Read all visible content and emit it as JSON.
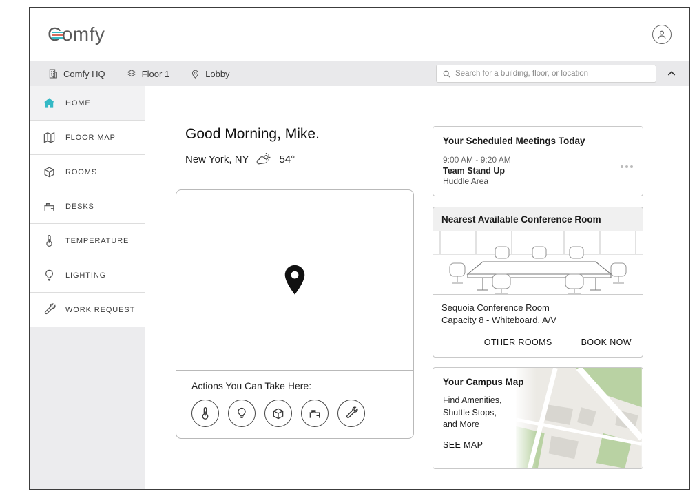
{
  "colors": {
    "accent": "#35b9c5",
    "logo_red": "#d96a5b"
  },
  "header": {
    "logo": "Comfy"
  },
  "breadcrumb": {
    "items": [
      {
        "icon": "building-icon",
        "label": "Comfy HQ"
      },
      {
        "icon": "layers-icon",
        "label": "Floor 1"
      },
      {
        "icon": "pin-icon",
        "label": "Lobby"
      }
    ]
  },
  "search": {
    "placeholder": "Search for a building, floor, or location"
  },
  "sidebar": {
    "items": [
      {
        "label": "HOME",
        "icon": "home-icon",
        "active": true
      },
      {
        "label": "FLOOR MAP",
        "icon": "floor-map-icon",
        "active": false
      },
      {
        "label": "ROOMS",
        "icon": "rooms-icon",
        "active": false
      },
      {
        "label": "DESKS",
        "icon": "desks-icon",
        "active": false
      },
      {
        "label": "TEMPERATURE",
        "icon": "thermometer-icon",
        "active": false
      },
      {
        "label": "LIGHTING",
        "icon": "lightbulb-icon",
        "active": false
      },
      {
        "label": "WORK REQUEST",
        "icon": "wrench-icon",
        "active": false
      }
    ]
  },
  "main": {
    "greeting": "Good Morning, Mike.",
    "city": "New York, NY",
    "temperature": "54°",
    "actions_title": "Actions You Can Take Here:"
  },
  "meetings": {
    "title": "Your Scheduled Meetings Today",
    "time": "9:00 AM - 9:20 AM",
    "name": "Team Stand Up",
    "room": "Huddle Area"
  },
  "conference": {
    "title": "Nearest Available Conference Room",
    "room_name": "Sequoia Conference Room",
    "details": "Capacity 8 - Whiteboard, A/V",
    "other_rooms_label": "OTHER ROOMS",
    "book_now_label": "BOOK NOW"
  },
  "campus": {
    "title": "Your Campus Map",
    "line1": "Find Amenities,",
    "line2": "Shuttle Stops,",
    "line3": "and More",
    "see_map_label": "SEE MAP"
  }
}
